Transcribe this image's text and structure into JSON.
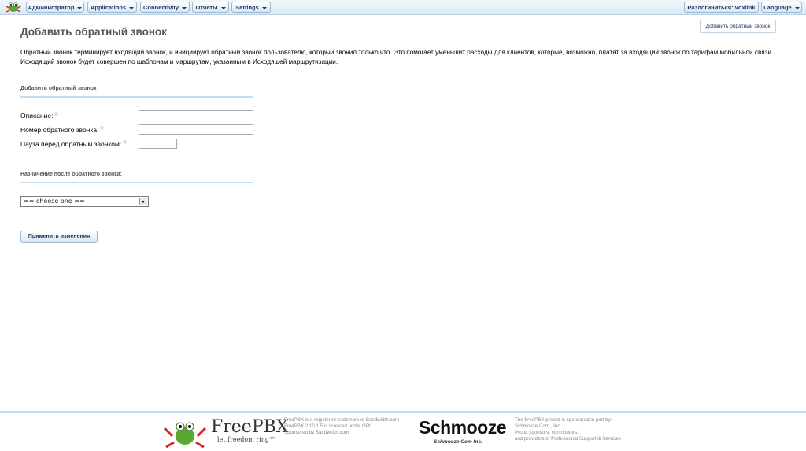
{
  "nav": {
    "menus": [
      {
        "label": "Администратор"
      },
      {
        "label": "Applications"
      },
      {
        "label": "Connectivity"
      },
      {
        "label": "Отчеты"
      },
      {
        "label": "Settings"
      }
    ],
    "logout": "Разлогиниться: voxlink",
    "language": "Language"
  },
  "page": {
    "title": "Добавить обратный звонок",
    "add_button": "Добавить обратный звонок",
    "description": "Обратный звонок терминирует входящий звонок, и инициирует обратный звонок пользователю, который звонил только что. Это помогает уменьшит расходы для клиентов, которые, возможно, платят за входящий звонок по тарифам мобильной связи. Исходящий звонок будет совершен по шаблонам и маршрутам, указанным в Исходящей маршрутизации."
  },
  "form": {
    "section1": "Добавить обратный звонок",
    "fields": [
      {
        "label": "Описание:",
        "value": ""
      },
      {
        "label": "Номер обратного звонка:",
        "value": ""
      },
      {
        "label": "Пауза перед обратным звонком:",
        "value": ""
      }
    ],
    "section2": "Назначение после обратного звонка:",
    "destination_selected": "== choose one ==",
    "submit": "Применить изменения"
  },
  "footer": {
    "freepbx_name": "FreePBX",
    "freepbx_slogan": "let freedom ring™",
    "freepbx_lines": [
      "FreePBX is a registered trademark of Bandwidth.com",
      "FreePBX 2.10.1.5 is licensed under GPL",
      "Sponsored by Bandwidth.com"
    ],
    "schmooze_name": "Schmooze",
    "schmooze_sub": "Schmooze Com Inc.",
    "sponsor_lines": [
      "The FreePBX project is sponsored in part by:",
      "Schmooze Com., Inc.",
      "Proud sponsors, contributors,",
      "and providers of Professional Support & Services"
    ]
  },
  "colors": {
    "accent": "#1d3d66",
    "nav_bg": "#dbe9f4",
    "divider": "#c5ddef"
  }
}
